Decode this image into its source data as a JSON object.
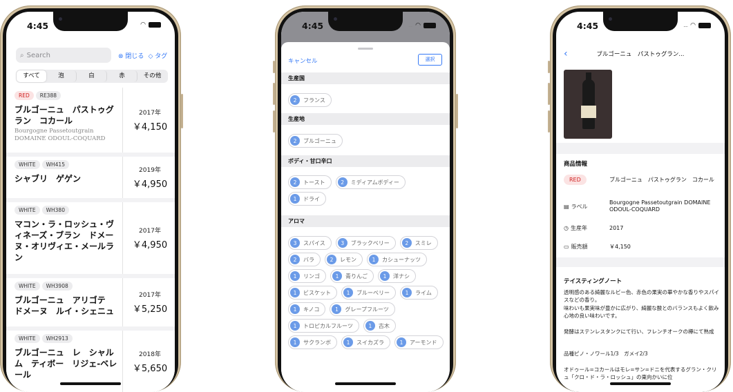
{
  "status_time": "4:45",
  "list_screen": {
    "search_placeholder": "Search",
    "close_label": "閉じる",
    "tag_label": "タグ",
    "segments": [
      "すべて",
      "泡",
      "白",
      "赤",
      "その他"
    ],
    "rows": [
      {
        "color": "RED",
        "code": "RE388",
        "name": "ブルゴーニュ　パストゥグラン　コカール",
        "subtitle": "Bourgogne Passetoutgrain DOMAINE ODOUL-COQUARD",
        "year": "2017年",
        "price": "￥4,150"
      },
      {
        "color": "WHITE",
        "code": "WH415",
        "name": "シャブリ　ゲゲン",
        "subtitle": "",
        "year": "2019年",
        "price": "￥4,950"
      },
      {
        "color": "WHITE",
        "code": "WH380",
        "name": "マコン・ラ・ロッシュ・ヴィネーズ・ブラン　ドメーヌ・オリヴィエ・メールラン",
        "subtitle": "",
        "year": "2017年",
        "price": "￥4,950"
      },
      {
        "color": "WHITE",
        "code": "WH3908",
        "name": "ブルゴーニュ　アリゴテ　ドメーヌ　ルイ・シェニュ",
        "subtitle": "",
        "year": "2017年",
        "price": "￥5,250"
      },
      {
        "color": "WHITE",
        "code": "WH2913",
        "name": "ブルゴーニュ　レ　シャルム　ティボー　リジェ-ベレール",
        "subtitle": "",
        "year": "2018年",
        "price": "￥5,650"
      }
    ]
  },
  "filter_screen": {
    "cancel_label": "キャンセル",
    "select_label": "選択",
    "sections": [
      {
        "title": "生産国",
        "chips": [
          {
            "count": "2",
            "label": "フランス"
          }
        ]
      },
      {
        "title": "生産地",
        "chips": [
          {
            "count": "2",
            "label": "ブルゴーニュ"
          }
        ]
      },
      {
        "title": "ボディ・甘口辛口",
        "chips": [
          {
            "count": "2",
            "label": "トースト"
          },
          {
            "count": "2",
            "label": "ミディアムボディー"
          },
          {
            "count": "1",
            "label": "ドライ"
          }
        ]
      },
      {
        "title": "アロマ",
        "chips": [
          {
            "count": "3",
            "label": "スパイス"
          },
          {
            "count": "3",
            "label": "ブラックベリー"
          },
          {
            "count": "2",
            "label": "スミレ"
          },
          {
            "count": "2",
            "label": "バラ"
          },
          {
            "count": "2",
            "label": "レモン"
          },
          {
            "count": "1",
            "label": "カシューナッツ"
          },
          {
            "count": "1",
            "label": "リンゴ"
          },
          {
            "count": "1",
            "label": "青りんご"
          },
          {
            "count": "1",
            "label": "洋ナシ"
          },
          {
            "count": "1",
            "label": "ビスケット"
          },
          {
            "count": "1",
            "label": "ブルーベリー"
          },
          {
            "count": "1",
            "label": "ライム"
          },
          {
            "count": "1",
            "label": "キノコ"
          },
          {
            "count": "1",
            "label": "グレープフルーツ"
          },
          {
            "count": "1",
            "label": "トロピカルフルーツ"
          },
          {
            "count": "1",
            "label": "古木"
          },
          {
            "count": "1",
            "label": "サクランボ"
          },
          {
            "count": "1",
            "label": "スイカズラ"
          },
          {
            "count": "1",
            "label": "アーモンド"
          }
        ]
      }
    ]
  },
  "detail_screen": {
    "nav_title": "ブルゴーニュ　パストゥグラン...",
    "info_title": "商品情報",
    "color_pill": "RED",
    "name_value": "ブルゴーニュ　パストゥグラン　コカール",
    "label_key": "ラベル",
    "label_value": "Bourgogne Passetoutgrain DOMAINE ODOUL-COQUARD",
    "year_key": "生産年",
    "year_value": "2017",
    "price_key": "販売額",
    "price_value": "￥4,150",
    "tasting_title": "テイスティングノート",
    "tasting_p1": "透明感のある綺麗なルビー色、赤色の果実の華やかな香りやスパイスなどの香り。",
    "tasting_p2": "味わいも果実味が豊かに広がり、綺麗な酸とのバランスもよく飲み心地の良い味わいです。",
    "tasting_p3": "発酵はステンレスタンクにて行い、フレンチオークの樽にて熟成",
    "tasting_p4": "品種ピノ・ノワール1/3　ガメイ2/3",
    "tasting_p5": "オドゥール=コカールはモレ=サン=ドニを代表するグラン・クリュ「クロ・ド・ラ・ロッシュ」の東向かいに位"
  }
}
